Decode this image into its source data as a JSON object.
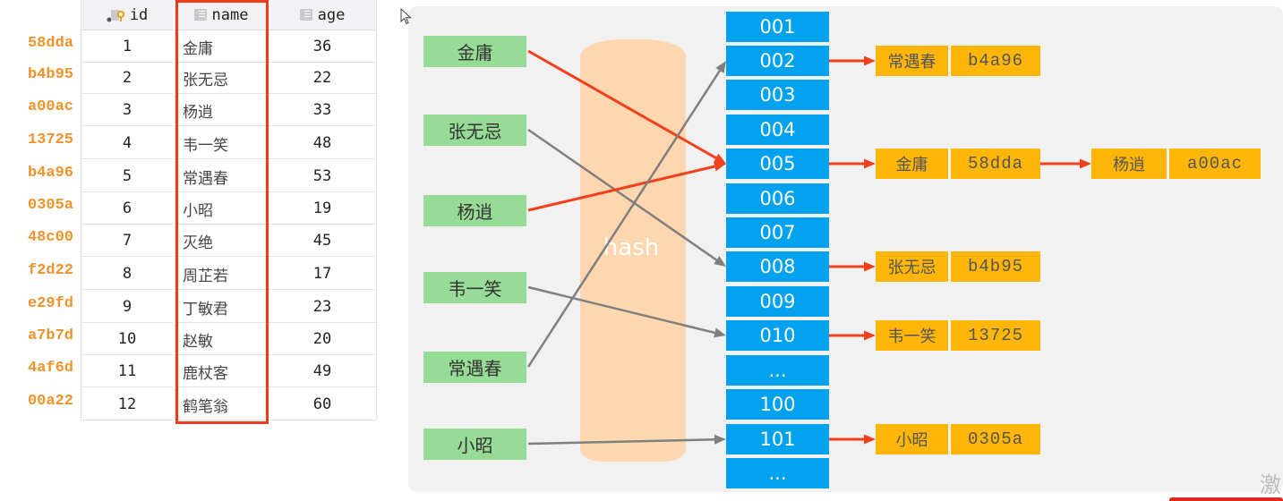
{
  "table": {
    "headers": {
      "id": "id",
      "name": "name",
      "age": "age"
    },
    "rows": [
      {
        "hash": "58dda",
        "id": "1",
        "name": "金庸",
        "age": "36"
      },
      {
        "hash": "b4b95",
        "id": "2",
        "name": "张无忌",
        "age": "22"
      },
      {
        "hash": "a00ac",
        "id": "3",
        "name": "杨逍",
        "age": "33"
      },
      {
        "hash": "13725",
        "id": "4",
        "name": "韦一笑",
        "age": "48"
      },
      {
        "hash": "b4a96",
        "id": "5",
        "name": "常遇春",
        "age": "53"
      },
      {
        "hash": "0305a",
        "id": "6",
        "name": "小昭",
        "age": "19"
      },
      {
        "hash": "48c00",
        "id": "7",
        "name": "灭绝",
        "age": "45"
      },
      {
        "hash": "f2d22",
        "id": "8",
        "name": "周芷若",
        "age": "17"
      },
      {
        "hash": "e29fd",
        "id": "9",
        "name": "丁敏君",
        "age": "23"
      },
      {
        "hash": "a7b7d",
        "id": "10",
        "name": "赵敏",
        "age": "20"
      },
      {
        "hash": "4af6d",
        "id": "11",
        "name": "鹿杖客",
        "age": "49"
      },
      {
        "hash": "00a22",
        "id": "12",
        "name": "鹤笔翁",
        "age": "60"
      }
    ],
    "highlight_color": "#ef3a1c",
    "hash_color": "#f0922a"
  },
  "diagram": {
    "keys": [
      "金庸",
      "张无忌",
      "杨逍",
      "韦一笑",
      "常遇春",
      "小昭"
    ],
    "hash_label": "hash",
    "slots": [
      "001",
      "002",
      "003",
      "004",
      "005",
      "006",
      "007",
      "008",
      "009",
      "010",
      "...",
      "100",
      "101",
      "..."
    ],
    "entries": [
      {
        "slot": "002",
        "chain": [
          {
            "name": "常遇春",
            "hash": "b4a96"
          }
        ]
      },
      {
        "slot": "005",
        "chain": [
          {
            "name": "金庸",
            "hash": "58dda"
          },
          {
            "name": "杨逍",
            "hash": "a00ac"
          }
        ]
      },
      {
        "slot": "008",
        "chain": [
          {
            "name": "张无忌",
            "hash": "b4b95"
          }
        ]
      },
      {
        "slot": "010",
        "chain": [
          {
            "name": "韦一笑",
            "hash": "13725"
          }
        ]
      },
      {
        "slot": "101",
        "chain": [
          {
            "name": "小昭",
            "hash": "0305a"
          }
        ]
      }
    ],
    "mappings": [
      {
        "key": "金庸",
        "slot": "005",
        "color": "red"
      },
      {
        "key": "张无忌",
        "slot": "008",
        "color": "gray"
      },
      {
        "key": "杨逍",
        "slot": "005",
        "color": "red"
      },
      {
        "key": "韦一笑",
        "slot": "010",
        "color": "gray"
      },
      {
        "key": "常遇春",
        "slot": "002",
        "color": "gray"
      },
      {
        "key": "小昭",
        "slot": "101",
        "color": "gray"
      }
    ],
    "colors": {
      "key_box": "#97dc96",
      "slot": "#00a2ee",
      "entry": "#ffb608",
      "red_arrow": "#f2401c",
      "gray_arrow": "#7f7f7f",
      "hash_band": "#fed7b0"
    }
  },
  "watermark": "激"
}
